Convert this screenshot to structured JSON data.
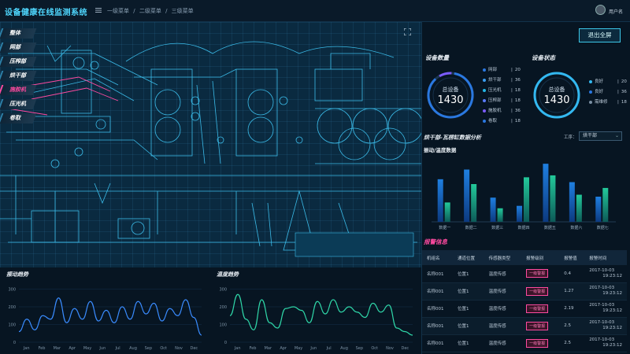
{
  "header": {
    "title": "设备健康在线监测系统",
    "breadcrumb": [
      "一级菜单",
      "/",
      "二级菜单",
      "/",
      "三级菜单"
    ],
    "user_name": "用户名"
  },
  "sidebar": {
    "items": [
      {
        "label": "整体",
        "active": false
      },
      {
        "label": "网部",
        "active": false
      },
      {
        "label": "压榨部",
        "active": false
      },
      {
        "label": "烘干部",
        "active": false
      },
      {
        "label": "施胶机",
        "active": true
      },
      {
        "label": "压光机",
        "active": false
      },
      {
        "label": "卷取",
        "active": false
      }
    ]
  },
  "exit_button": "退出全屏",
  "device_count": {
    "title": "设备数量",
    "ring_label": "总设备",
    "ring_value": "1430",
    "legend": [
      {
        "label": "网部",
        "value": "20"
      },
      {
        "label": "烘干部",
        "value": "36"
      },
      {
        "label": "压光机",
        "value": "18"
      },
      {
        "label": "压榨部",
        "value": "18"
      },
      {
        "label": "施胶机",
        "value": "36"
      },
      {
        "label": "卷取",
        "value": "18"
      }
    ]
  },
  "device_status": {
    "title": "设备状态",
    "ring_label": "总设备",
    "ring_value": "1430",
    "legend": [
      {
        "label": "良好",
        "value": "20"
      },
      {
        "label": "良好",
        "value": "36"
      },
      {
        "label": "需维修",
        "value": "18"
      }
    ]
  },
  "analysis": {
    "title": "烘干部-瓦楞缸数据分析",
    "process_label": "工序：",
    "process_value": "烘干部",
    "bar_subtitle": "振动/温度数据"
  },
  "alarm": {
    "title": "报警信息",
    "columns": [
      "机组名",
      "通道位置",
      "传感器类型",
      "报警级别",
      "报警值",
      "报警时间"
    ],
    "rows": [
      {
        "name": "名称001",
        "pos": "位置1",
        "sensor": "温度传感",
        "level": "一级警报",
        "value": "0.4",
        "date": "2017-10-03",
        "time": "19:23:12"
      },
      {
        "name": "名称001",
        "pos": "位置1",
        "sensor": "温度传感",
        "level": "一级警报",
        "value": "1.27",
        "date": "2017-10-03",
        "time": "19:23:12"
      },
      {
        "name": "名称001",
        "pos": "位置1",
        "sensor": "温度传感",
        "level": "一级警报",
        "value": "2.19",
        "date": "2017-10-03",
        "time": "19:23:12"
      },
      {
        "name": "名称001",
        "pos": "位置1",
        "sensor": "温度传感",
        "level": "一级警报",
        "value": "2.5",
        "date": "2017-10-03",
        "time": "19:23:12"
      },
      {
        "name": "名称001",
        "pos": "位置1",
        "sensor": "温度传感",
        "level": "一级警报",
        "value": "2.5",
        "date": "2017-10-03",
        "time": "19:23:12"
      }
    ]
  },
  "colors": {
    "accent": "#4fd8ff",
    "alarm": "#ff4aa0",
    "bar_blue": "#1f7fe0",
    "bar_green": "#23c99a",
    "line_blue": "#3a8cff",
    "line_green": "#2fd6a8"
  },
  "chart_data": [
    {
      "type": "bar",
      "title": "振动/温度数据",
      "categories": [
        "数据一",
        "数据二",
        "数据三",
        "数据四",
        "数据五",
        "数据六",
        "数据七"
      ],
      "series": [
        {
          "values": [
            88,
            108,
            50,
            33,
            120,
            82,
            52
          ]
        },
        {
          "values": [
            40,
            78,
            28,
            92,
            96,
            56,
            70
          ]
        }
      ],
      "ylim": [
        0,
        130
      ]
    },
    {
      "type": "line",
      "title": "振动趋势",
      "categories": [
        "Jan",
        "Feb",
        "Mar",
        "Apr",
        "May",
        "Jun",
        "Jul",
        "Aug",
        "Sep",
        "Oct",
        "Nov",
        "Dec"
      ],
      "yticks": [
        0,
        100,
        200,
        300
      ],
      "ylim": [
        0,
        320
      ],
      "values": [
        60,
        130,
        70,
        150,
        130,
        250,
        110,
        190,
        130,
        230,
        120,
        180,
        110,
        200,
        130,
        230,
        160,
        220,
        120,
        190,
        150,
        240,
        140,
        40
      ]
    },
    {
      "type": "line",
      "title": "温度趋势",
      "categories": [
        "Jan",
        "Feb",
        "Mar",
        "Apr",
        "May",
        "Jun",
        "Jul",
        "Aug",
        "Sep",
        "Oct",
        "Nov",
        "Dec"
      ],
      "yticks": [
        0,
        100,
        200,
        300
      ],
      "ylim": [
        0,
        320
      ],
      "values": [
        150,
        270,
        130,
        70,
        240,
        110,
        80,
        190,
        200,
        180,
        110,
        230,
        160,
        240,
        170,
        200,
        170,
        140,
        220,
        170,
        210,
        80,
        60,
        40
      ]
    }
  ]
}
